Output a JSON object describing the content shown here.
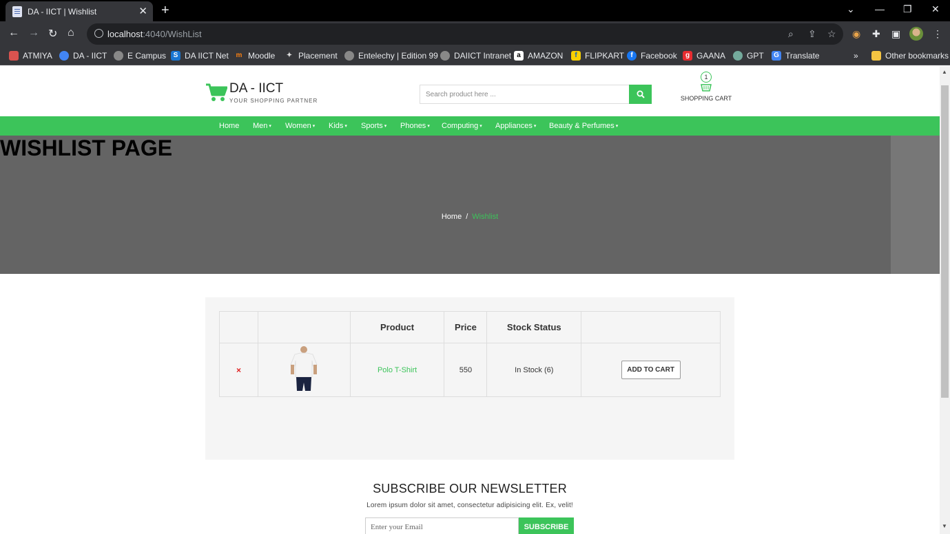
{
  "browser": {
    "tab_title": "DA - IICT | Wishlist",
    "url_host": "localhost",
    "url_path": ":4040/WishList",
    "bookmarks": [
      {
        "label": "ATMIYA",
        "color": "#d9534f",
        "icon": "atmiya-icon"
      },
      {
        "label": "DA - IICT",
        "color": "#4285f4",
        "icon": "daiict-icon"
      },
      {
        "label": "E Campus",
        "color": "#888888",
        "icon": "globe-icon"
      },
      {
        "label": "DA IICT Net",
        "color": "#1976d2",
        "icon": "daiict-net-icon"
      },
      {
        "label": "Moodle",
        "color": "#f98012",
        "icon": "moodle-icon"
      },
      {
        "label": "Placement",
        "color": "#444444",
        "icon": "placement-icon"
      },
      {
        "label": "Entelechy | Edition 99",
        "color": "#888888",
        "icon": "globe-icon"
      },
      {
        "label": "DAIICT Intranet",
        "color": "#888888",
        "icon": "globe-icon"
      },
      {
        "label": "AMAZON",
        "color": "#ffffff",
        "icon": "amazon-icon"
      },
      {
        "label": "FLIPKART",
        "color": "#f8d000",
        "icon": "flipkart-icon"
      },
      {
        "label": "Facebook",
        "color": "#1877f2",
        "icon": "facebook-icon"
      },
      {
        "label": "GAANA",
        "color": "#e72c30",
        "icon": "gaana-icon"
      },
      {
        "label": "GPT",
        "color": "#74aa9c",
        "icon": "gpt-icon"
      },
      {
        "label": "Translate",
        "color": "#4285f4",
        "icon": "translate-icon"
      }
    ],
    "more_bookmarks": "»",
    "other_bookmarks": "Other bookmarks"
  },
  "header": {
    "brand": "DA - IICT",
    "tagline": "YOUR SHOPPING PARTNER",
    "search_placeholder": "Search product here ...",
    "cart_count": "1",
    "cart_label": "SHOPPING CART"
  },
  "menu": [
    {
      "label": "Home",
      "dropdown": false
    },
    {
      "label": "Men",
      "dropdown": true
    },
    {
      "label": "Women",
      "dropdown": true
    },
    {
      "label": "Kids",
      "dropdown": true
    },
    {
      "label": "Sports",
      "dropdown": true
    },
    {
      "label": "Phones",
      "dropdown": true
    },
    {
      "label": "Computing",
      "dropdown": true
    },
    {
      "label": "Appliances",
      "dropdown": true
    },
    {
      "label": "Beauty & Perfumes",
      "dropdown": true
    }
  ],
  "banner": {
    "title": "WISHLIST PAGE",
    "breadcrumb_home": "Home",
    "breadcrumb_sep": "/",
    "breadcrumb_current": "Wishlist"
  },
  "wishlist": {
    "columns": [
      "",
      "",
      "Product",
      "Price",
      "Stock Status",
      ""
    ],
    "rows": [
      {
        "product": "Polo T-Shirt",
        "price": "550",
        "stock": "In Stock (6)",
        "action": "ADD TO CART",
        "remove": "×"
      }
    ]
  },
  "newsletter": {
    "title": "SUBSCRIBE OUR NEWSLETTER",
    "text": "Lorem ipsum dolor sit amet, consectetur adipisicing elit. Ex, velit!",
    "email_placeholder": "Enter your Email",
    "button": "SUBSCRIBE"
  },
  "colors": {
    "accent": "#3cc45a",
    "banner": "#646464",
    "chrome_dark": "#35363a"
  }
}
